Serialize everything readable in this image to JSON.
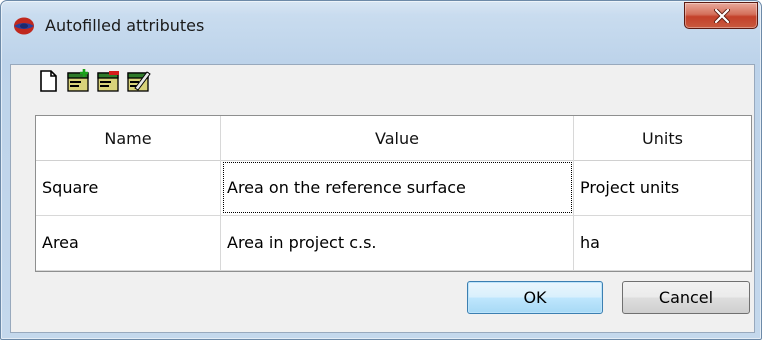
{
  "window": {
    "title": "Autofilled attributes",
    "close_symbol": "x"
  },
  "toolbar": {
    "buttons": [
      {
        "icon": "new-document-icon",
        "tooltip": ""
      },
      {
        "icon": "add-record-icon",
        "tooltip": ""
      },
      {
        "icon": "remove-record-icon",
        "tooltip": ""
      },
      {
        "icon": "edit-record-icon",
        "tooltip": ""
      }
    ]
  },
  "table": {
    "columns": [
      "Name",
      "Value",
      "Units"
    ],
    "rows": [
      {
        "name": "Square",
        "value": "Area on the reference surface",
        "units": "Project units"
      },
      {
        "name": "Area",
        "value": "Area in project c.s.",
        "units": "ha"
      }
    ]
  },
  "buttons": {
    "ok": "OK",
    "cancel": "Cancel"
  },
  "colors": {
    "close_button": "#c3402a",
    "ok_button_border": "#3c7fb1",
    "window_frame": "#bdd3ea"
  }
}
